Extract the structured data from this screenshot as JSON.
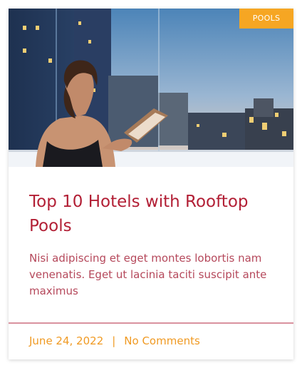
{
  "post": {
    "category_badge": "POOLS",
    "title": "Top 10 Hotels with Rooftop Pools",
    "excerpt": "Nisi adipiscing et eget montes lobortis nam venenatis. Eget ut lacinia taciti suscipit ante maximus",
    "date": "June 24, 2022",
    "separator": "|",
    "comments": "No Comments"
  },
  "colors": {
    "badge_bg": "#f6a623",
    "title": "#b21f35",
    "excerpt": "#b5485b",
    "meta": "#f09a23",
    "divider": "#d9929e"
  }
}
